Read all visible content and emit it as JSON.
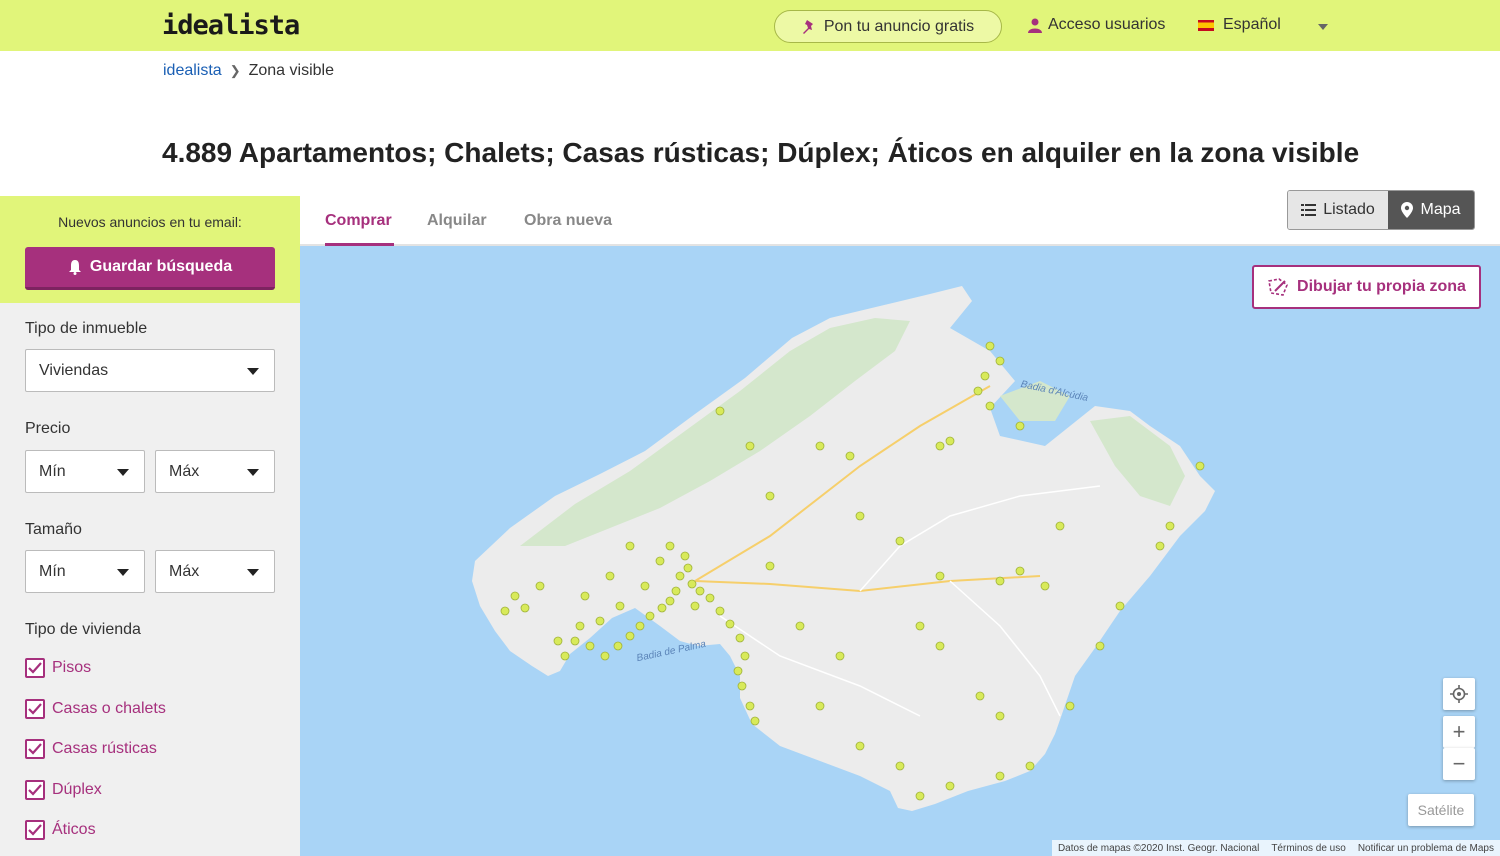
{
  "header": {
    "logo": "idealista",
    "post_ad_label": "Pon tu anuncio gratis",
    "login_label": "Acceso usuarios",
    "language_label": "Español"
  },
  "breadcrumb": {
    "home": "idealista",
    "current": "Zona visible"
  },
  "page_title": "4.889 Apartamentos; Chalets; Casas rústicas; Dúplex; Áticos en alquiler en la zona visible",
  "sidebar": {
    "email_label": "Nuevos anuncios en tu email:",
    "save_search_label": "Guardar búsqueda",
    "property_type": {
      "label": "Tipo de inmueble",
      "value": "Viviendas"
    },
    "price": {
      "label": "Precio",
      "min": "Mín",
      "max": "Máx"
    },
    "size": {
      "label": "Tamaño",
      "min": "Mín",
      "max": "Máx"
    },
    "housing_type": {
      "label": "Tipo de vivienda",
      "options": [
        {
          "label": "Pisos",
          "checked": true
        },
        {
          "label": "Casas o chalets",
          "checked": true
        },
        {
          "label": "Casas rústicas",
          "checked": true
        },
        {
          "label": "Dúplex",
          "checked": true
        },
        {
          "label": "Áticos",
          "checked": true
        }
      ]
    }
  },
  "tabs": [
    {
      "label": "Comprar",
      "active": true
    },
    {
      "label": "Alquilar",
      "active": false
    },
    {
      "label": "Obra nueva",
      "active": false
    }
  ],
  "view_toggle": {
    "list_label": "Listado",
    "map_label": "Mapa",
    "active": "Mapa"
  },
  "map": {
    "draw_zone_label": "Dibujar tu propia zona",
    "satellite_label": "Satélite",
    "zoom_in": "+",
    "zoom_out": "−",
    "labels": {
      "bay_alcudia": "Badia d'Alcúdia",
      "bay_palma": "Badia de Palma"
    },
    "attribution": {
      "data": "Datos de mapas ©2020 Inst. Geogr. Nacional",
      "terms": "Términos de uso",
      "report": "Notificar un problema de Maps"
    }
  },
  "colors": {
    "brand_purple": "#a6307d",
    "header_lime": "#e1f57a",
    "sea": "#a9d4f6",
    "land": "#ececec",
    "marker": "#d8ea5a"
  }
}
